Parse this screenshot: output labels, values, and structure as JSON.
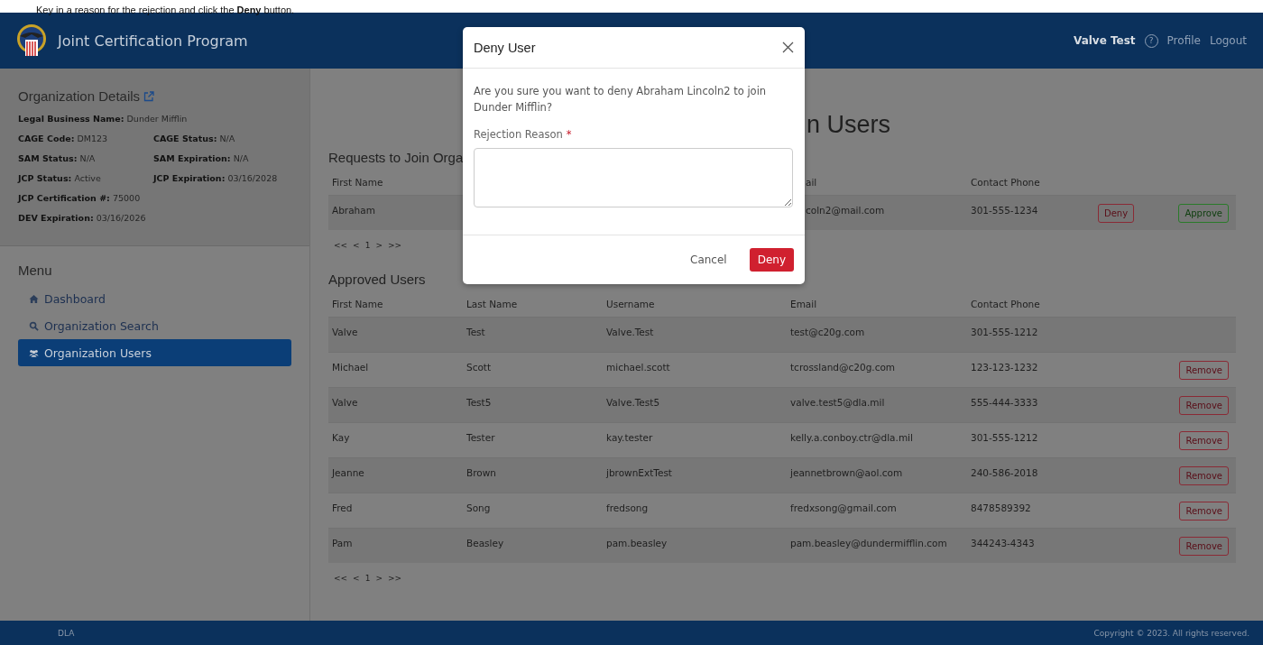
{
  "instruction": "Key in a reason for the rejection and click the **Deny** button.",
  "header": {
    "title": "Joint Certification Program",
    "user": "Valve Test",
    "help": "?",
    "links": [
      "Profile",
      "Logout"
    ]
  },
  "organization_details": {
    "title": "Organization Details",
    "rows": [
      [
        {
          "label": "Legal Business Name:",
          "value": "Dunder Mifflin"
        }
      ],
      [
        {
          "label": "CAGE Code:",
          "value": "DM123"
        },
        {
          "label": "CAGE Status:",
          "value": "N/A"
        }
      ],
      [
        {
          "label": "SAM Status:",
          "value": "N/A"
        },
        {
          "label": "SAM Expiration:",
          "value": "N/A"
        }
      ],
      [
        {
          "label": "JCP Status:",
          "value": "Active"
        },
        {
          "label": "JCP Expiration:",
          "value": "03/16/2028"
        }
      ],
      [
        {
          "label": "JCP Certification #:",
          "value": "75000"
        }
      ],
      [
        {
          "label": "DEV Expiration:",
          "value": "03/16/2026"
        }
      ]
    ]
  },
  "menu": {
    "title": "Menu",
    "items": [
      {
        "label": "Dashboard",
        "kind": "home",
        "selected": false
      },
      {
        "label": "Organization Search",
        "kind": "search",
        "selected": false
      },
      {
        "label": "Organization Users",
        "kind": "users",
        "selected": true
      }
    ]
  },
  "page_title": "n Users",
  "requests": {
    "title": "Requests to Join Orga",
    "columns": [
      "First Name",
      "ail",
      "Contact Phone"
    ],
    "rows": [
      {
        "first_name": "Abraham",
        "email": "coln2@mail.com",
        "phone": "301-555-1234",
        "deny": "Deny",
        "approve": "Approve"
      }
    ],
    "pagination": [
      "<<",
      "<",
      "1",
      ">",
      ">>"
    ]
  },
  "approved": {
    "title": "Approved Users",
    "columns": [
      "First Name",
      "Last Name",
      "Username",
      "Email",
      "Contact Phone"
    ],
    "rows": [
      {
        "first_name": "Valve",
        "last_name": "Test",
        "username": "Valve.Test",
        "email": "test@c20g.com",
        "phone": "301-555-1212"
      },
      {
        "first_name": "Michael",
        "last_name": "Scott",
        "username": "michael.scott",
        "email": "tcrossland@c20g.com",
        "phone": "123-123-1232",
        "action": "Remove"
      },
      {
        "first_name": "Valve",
        "last_name": "Test5",
        "username": "Valve.Test5",
        "email": "valve.test5@dla.mil",
        "phone": "555-444-3333",
        "action": "Remove"
      },
      {
        "first_name": "Kay",
        "last_name": "Tester",
        "username": "kay.tester",
        "email": "kelly.a.conboy.ctr@dla.mil",
        "phone": "301-555-1212",
        "action": "Remove"
      },
      {
        "first_name": "Jeanne",
        "last_name": "Brown",
        "username": "jbrownExtTest",
        "email": "jeannetbrown@aol.com",
        "phone": "240-586-2018",
        "action": "Remove"
      },
      {
        "first_name": "Fred",
        "last_name": "Song",
        "username": "fredsong",
        "email": "fredxsong@gmail.com",
        "phone": "8478589392",
        "action": "Remove"
      },
      {
        "first_name": "Pam",
        "last_name": "Beasley",
        "username": "pam.beasley",
        "email": "pam.beasley@dundermifflin.com",
        "phone": "344243-4343",
        "action": "Remove"
      }
    ],
    "pagination": [
      "<<",
      "<",
      "1",
      ">",
      ">>"
    ]
  },
  "modal": {
    "title": "Deny User",
    "message": "Are you sure you want to deny Abraham Lincoln2 to join Dunder Mifflin?",
    "field_label": "Rejection Reason",
    "required_mark": "*",
    "buttons": [
      {
        "label": "Cancel",
        "kind": "secondary"
      },
      {
        "label": "Deny",
        "kind": "danger"
      }
    ]
  },
  "footer": {
    "left": "DLA",
    "right": "Copyright © 2023. All rights reserved."
  }
}
